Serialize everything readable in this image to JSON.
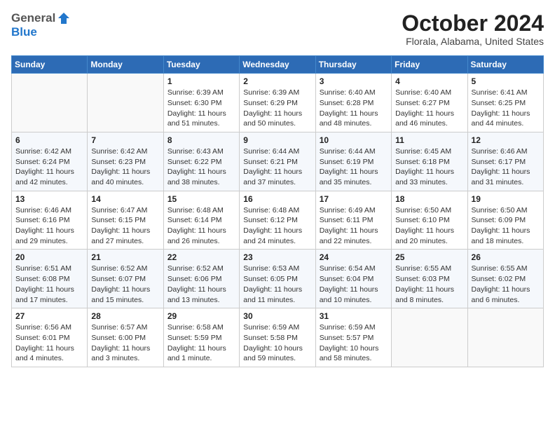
{
  "header": {
    "logo_general": "General",
    "logo_blue": "Blue",
    "title": "October 2024",
    "subtitle": "Florala, Alabama, United States"
  },
  "calendar": {
    "days_of_week": [
      "Sunday",
      "Monday",
      "Tuesday",
      "Wednesday",
      "Thursday",
      "Friday",
      "Saturday"
    ],
    "weeks": [
      [
        {
          "day": "",
          "detail": ""
        },
        {
          "day": "",
          "detail": ""
        },
        {
          "day": "1",
          "detail": "Sunrise: 6:39 AM\nSunset: 6:30 PM\nDaylight: 11 hours\nand 51 minutes."
        },
        {
          "day": "2",
          "detail": "Sunrise: 6:39 AM\nSunset: 6:29 PM\nDaylight: 11 hours\nand 50 minutes."
        },
        {
          "day": "3",
          "detail": "Sunrise: 6:40 AM\nSunset: 6:28 PM\nDaylight: 11 hours\nand 48 minutes."
        },
        {
          "day": "4",
          "detail": "Sunrise: 6:40 AM\nSunset: 6:27 PM\nDaylight: 11 hours\nand 46 minutes."
        },
        {
          "day": "5",
          "detail": "Sunrise: 6:41 AM\nSunset: 6:25 PM\nDaylight: 11 hours\nand 44 minutes."
        }
      ],
      [
        {
          "day": "6",
          "detail": "Sunrise: 6:42 AM\nSunset: 6:24 PM\nDaylight: 11 hours\nand 42 minutes."
        },
        {
          "day": "7",
          "detail": "Sunrise: 6:42 AM\nSunset: 6:23 PM\nDaylight: 11 hours\nand 40 minutes."
        },
        {
          "day": "8",
          "detail": "Sunrise: 6:43 AM\nSunset: 6:22 PM\nDaylight: 11 hours\nand 38 minutes."
        },
        {
          "day": "9",
          "detail": "Sunrise: 6:44 AM\nSunset: 6:21 PM\nDaylight: 11 hours\nand 37 minutes."
        },
        {
          "day": "10",
          "detail": "Sunrise: 6:44 AM\nSunset: 6:19 PM\nDaylight: 11 hours\nand 35 minutes."
        },
        {
          "day": "11",
          "detail": "Sunrise: 6:45 AM\nSunset: 6:18 PM\nDaylight: 11 hours\nand 33 minutes."
        },
        {
          "day": "12",
          "detail": "Sunrise: 6:46 AM\nSunset: 6:17 PM\nDaylight: 11 hours\nand 31 minutes."
        }
      ],
      [
        {
          "day": "13",
          "detail": "Sunrise: 6:46 AM\nSunset: 6:16 PM\nDaylight: 11 hours\nand 29 minutes."
        },
        {
          "day": "14",
          "detail": "Sunrise: 6:47 AM\nSunset: 6:15 PM\nDaylight: 11 hours\nand 27 minutes."
        },
        {
          "day": "15",
          "detail": "Sunrise: 6:48 AM\nSunset: 6:14 PM\nDaylight: 11 hours\nand 26 minutes."
        },
        {
          "day": "16",
          "detail": "Sunrise: 6:48 AM\nSunset: 6:12 PM\nDaylight: 11 hours\nand 24 minutes."
        },
        {
          "day": "17",
          "detail": "Sunrise: 6:49 AM\nSunset: 6:11 PM\nDaylight: 11 hours\nand 22 minutes."
        },
        {
          "day": "18",
          "detail": "Sunrise: 6:50 AM\nSunset: 6:10 PM\nDaylight: 11 hours\nand 20 minutes."
        },
        {
          "day": "19",
          "detail": "Sunrise: 6:50 AM\nSunset: 6:09 PM\nDaylight: 11 hours\nand 18 minutes."
        }
      ],
      [
        {
          "day": "20",
          "detail": "Sunrise: 6:51 AM\nSunset: 6:08 PM\nDaylight: 11 hours\nand 17 minutes."
        },
        {
          "day": "21",
          "detail": "Sunrise: 6:52 AM\nSunset: 6:07 PM\nDaylight: 11 hours\nand 15 minutes."
        },
        {
          "day": "22",
          "detail": "Sunrise: 6:52 AM\nSunset: 6:06 PM\nDaylight: 11 hours\nand 13 minutes."
        },
        {
          "day": "23",
          "detail": "Sunrise: 6:53 AM\nSunset: 6:05 PM\nDaylight: 11 hours\nand 11 minutes."
        },
        {
          "day": "24",
          "detail": "Sunrise: 6:54 AM\nSunset: 6:04 PM\nDaylight: 11 hours\nand 10 minutes."
        },
        {
          "day": "25",
          "detail": "Sunrise: 6:55 AM\nSunset: 6:03 PM\nDaylight: 11 hours\nand 8 minutes."
        },
        {
          "day": "26",
          "detail": "Sunrise: 6:55 AM\nSunset: 6:02 PM\nDaylight: 11 hours\nand 6 minutes."
        }
      ],
      [
        {
          "day": "27",
          "detail": "Sunrise: 6:56 AM\nSunset: 6:01 PM\nDaylight: 11 hours\nand 4 minutes."
        },
        {
          "day": "28",
          "detail": "Sunrise: 6:57 AM\nSunset: 6:00 PM\nDaylight: 11 hours\nand 3 minutes."
        },
        {
          "day": "29",
          "detail": "Sunrise: 6:58 AM\nSunset: 5:59 PM\nDaylight: 11 hours\nand 1 minute."
        },
        {
          "day": "30",
          "detail": "Sunrise: 6:59 AM\nSunset: 5:58 PM\nDaylight: 10 hours\nand 59 minutes."
        },
        {
          "day": "31",
          "detail": "Sunrise: 6:59 AM\nSunset: 5:57 PM\nDaylight: 10 hours\nand 58 minutes."
        },
        {
          "day": "",
          "detail": ""
        },
        {
          "day": "",
          "detail": ""
        }
      ]
    ]
  }
}
